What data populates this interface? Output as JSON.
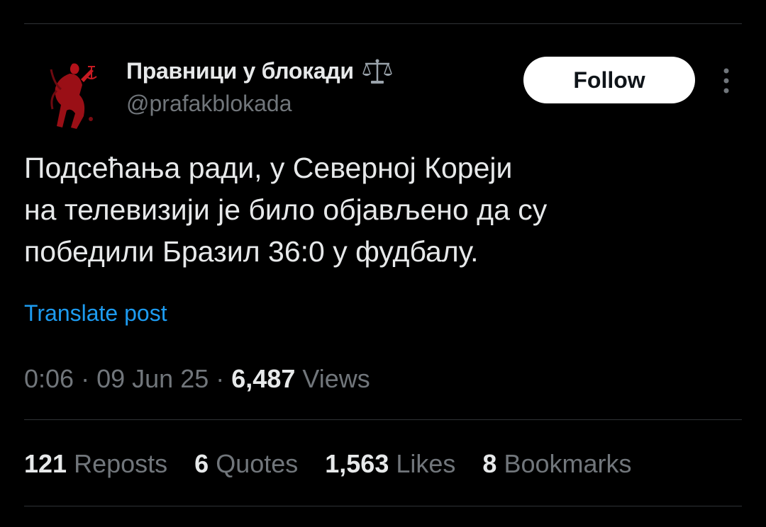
{
  "author": {
    "display_name": "Правници у блокади",
    "handle": "@prafakblokada",
    "name_emoji": "scales-icon",
    "avatar": "avatar-red-figure"
  },
  "follow_label": "Follow",
  "tweet": {
    "text": "Подсећања ради, у Северној Кореји\nна телевизији је било објављено да су\nпобедили Бразил 36:0 у фудбалу.",
    "translate_label": "Translate post",
    "time": "0:06",
    "date": "09 Jun 25",
    "separator": "·",
    "views_count": "6,487",
    "views_label": "Views"
  },
  "stats": {
    "reposts_count": "121",
    "reposts_label": "Reposts",
    "quotes_count": "6",
    "quotes_label": "Quotes",
    "likes_count": "1,563",
    "likes_label": "Likes",
    "bookmarks_count": "8",
    "bookmarks_label": "Bookmarks"
  },
  "colors": {
    "background": "#000000",
    "text_primary": "#e7e9ea",
    "text_secondary": "#71767b",
    "link": "#1d9bf0",
    "divider": "#2f3336",
    "follow_bg": "#ffffff"
  }
}
